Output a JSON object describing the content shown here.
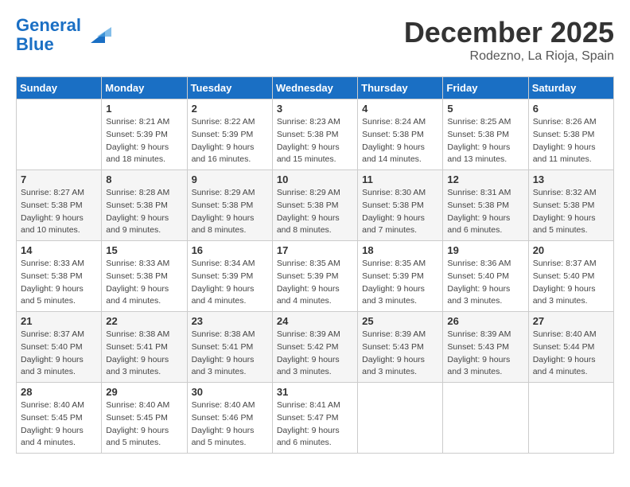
{
  "header": {
    "logo_line1": "General",
    "logo_line2": "Blue",
    "month": "December 2025",
    "location": "Rodezno, La Rioja, Spain"
  },
  "weekdays": [
    "Sunday",
    "Monday",
    "Tuesday",
    "Wednesday",
    "Thursday",
    "Friday",
    "Saturday"
  ],
  "weeks": [
    [
      {
        "day": "",
        "info": ""
      },
      {
        "day": "1",
        "info": "Sunrise: 8:21 AM\nSunset: 5:39 PM\nDaylight: 9 hours\nand 18 minutes."
      },
      {
        "day": "2",
        "info": "Sunrise: 8:22 AM\nSunset: 5:39 PM\nDaylight: 9 hours\nand 16 minutes."
      },
      {
        "day": "3",
        "info": "Sunrise: 8:23 AM\nSunset: 5:38 PM\nDaylight: 9 hours\nand 15 minutes."
      },
      {
        "day": "4",
        "info": "Sunrise: 8:24 AM\nSunset: 5:38 PM\nDaylight: 9 hours\nand 14 minutes."
      },
      {
        "day": "5",
        "info": "Sunrise: 8:25 AM\nSunset: 5:38 PM\nDaylight: 9 hours\nand 13 minutes."
      },
      {
        "day": "6",
        "info": "Sunrise: 8:26 AM\nSunset: 5:38 PM\nDaylight: 9 hours\nand 11 minutes."
      }
    ],
    [
      {
        "day": "7",
        "info": "Sunrise: 8:27 AM\nSunset: 5:38 PM\nDaylight: 9 hours\nand 10 minutes."
      },
      {
        "day": "8",
        "info": "Sunrise: 8:28 AM\nSunset: 5:38 PM\nDaylight: 9 hours\nand 9 minutes."
      },
      {
        "day": "9",
        "info": "Sunrise: 8:29 AM\nSunset: 5:38 PM\nDaylight: 9 hours\nand 8 minutes."
      },
      {
        "day": "10",
        "info": "Sunrise: 8:29 AM\nSunset: 5:38 PM\nDaylight: 9 hours\nand 8 minutes."
      },
      {
        "day": "11",
        "info": "Sunrise: 8:30 AM\nSunset: 5:38 PM\nDaylight: 9 hours\nand 7 minutes."
      },
      {
        "day": "12",
        "info": "Sunrise: 8:31 AM\nSunset: 5:38 PM\nDaylight: 9 hours\nand 6 minutes."
      },
      {
        "day": "13",
        "info": "Sunrise: 8:32 AM\nSunset: 5:38 PM\nDaylight: 9 hours\nand 5 minutes."
      }
    ],
    [
      {
        "day": "14",
        "info": "Sunrise: 8:33 AM\nSunset: 5:38 PM\nDaylight: 9 hours\nand 5 minutes."
      },
      {
        "day": "15",
        "info": "Sunrise: 8:33 AM\nSunset: 5:38 PM\nDaylight: 9 hours\nand 4 minutes."
      },
      {
        "day": "16",
        "info": "Sunrise: 8:34 AM\nSunset: 5:39 PM\nDaylight: 9 hours\nand 4 minutes."
      },
      {
        "day": "17",
        "info": "Sunrise: 8:35 AM\nSunset: 5:39 PM\nDaylight: 9 hours\nand 4 minutes."
      },
      {
        "day": "18",
        "info": "Sunrise: 8:35 AM\nSunset: 5:39 PM\nDaylight: 9 hours\nand 3 minutes."
      },
      {
        "day": "19",
        "info": "Sunrise: 8:36 AM\nSunset: 5:40 PM\nDaylight: 9 hours\nand 3 minutes."
      },
      {
        "day": "20",
        "info": "Sunrise: 8:37 AM\nSunset: 5:40 PM\nDaylight: 9 hours\nand 3 minutes."
      }
    ],
    [
      {
        "day": "21",
        "info": "Sunrise: 8:37 AM\nSunset: 5:40 PM\nDaylight: 9 hours\nand 3 minutes."
      },
      {
        "day": "22",
        "info": "Sunrise: 8:38 AM\nSunset: 5:41 PM\nDaylight: 9 hours\nand 3 minutes."
      },
      {
        "day": "23",
        "info": "Sunrise: 8:38 AM\nSunset: 5:41 PM\nDaylight: 9 hours\nand 3 minutes."
      },
      {
        "day": "24",
        "info": "Sunrise: 8:39 AM\nSunset: 5:42 PM\nDaylight: 9 hours\nand 3 minutes."
      },
      {
        "day": "25",
        "info": "Sunrise: 8:39 AM\nSunset: 5:43 PM\nDaylight: 9 hours\nand 3 minutes."
      },
      {
        "day": "26",
        "info": "Sunrise: 8:39 AM\nSunset: 5:43 PM\nDaylight: 9 hours\nand 3 minutes."
      },
      {
        "day": "27",
        "info": "Sunrise: 8:40 AM\nSunset: 5:44 PM\nDaylight: 9 hours\nand 4 minutes."
      }
    ],
    [
      {
        "day": "28",
        "info": "Sunrise: 8:40 AM\nSunset: 5:45 PM\nDaylight: 9 hours\nand 4 minutes."
      },
      {
        "day": "29",
        "info": "Sunrise: 8:40 AM\nSunset: 5:45 PM\nDaylight: 9 hours\nand 5 minutes."
      },
      {
        "day": "30",
        "info": "Sunrise: 8:40 AM\nSunset: 5:46 PM\nDaylight: 9 hours\nand 5 minutes."
      },
      {
        "day": "31",
        "info": "Sunrise: 8:41 AM\nSunset: 5:47 PM\nDaylight: 9 hours\nand 6 minutes."
      },
      {
        "day": "",
        "info": ""
      },
      {
        "day": "",
        "info": ""
      },
      {
        "day": "",
        "info": ""
      }
    ]
  ]
}
